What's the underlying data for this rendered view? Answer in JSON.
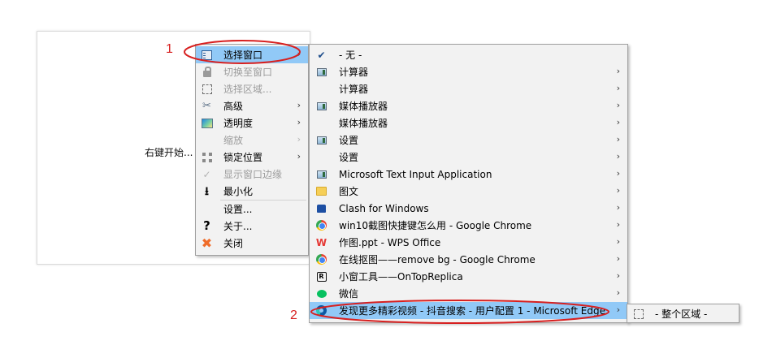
{
  "background_window": {
    "hint": "右键开始..."
  },
  "main_menu": [
    {
      "label": "选择窗口",
      "icon": "select-window-icon",
      "arrow": "›",
      "state": "highlight"
    },
    {
      "label": "切换至窗口",
      "icon": "lock-icon",
      "state": "disabled"
    },
    {
      "label": "选择区域...",
      "icon": "select-region-icon",
      "state": "disabled"
    },
    {
      "label": "高级",
      "icon": "wrench-icon",
      "arrow": "›"
    },
    {
      "label": "透明度",
      "icon": "opacity-icon",
      "arrow": "›"
    },
    {
      "label": "缩放",
      "arrow": "›",
      "state": "disabled"
    },
    {
      "label": "锁定位置",
      "icon": "grid-icon",
      "arrow": "›"
    },
    {
      "label": "显示窗口边缘",
      "icon": "check-icon",
      "state": "disabled"
    },
    {
      "label": "最小化",
      "icon": "minimize-icon"
    },
    {
      "label": "设置...",
      "separator_before": true
    },
    {
      "label": "关于...",
      "icon": "question-icon"
    },
    {
      "label": "关闭",
      "icon": "close-icon"
    }
  ],
  "window_menu": [
    {
      "label": "- 无 -",
      "icon": "check-icon"
    },
    {
      "label": "计算器",
      "icon": "app-window-icon",
      "arrow": "›"
    },
    {
      "label": "计算器",
      "arrow": "›"
    },
    {
      "label": "媒体播放器",
      "icon": "app-window-icon",
      "arrow": "›"
    },
    {
      "label": "媒体播放器",
      "arrow": "›"
    },
    {
      "label": "设置",
      "icon": "app-window-icon",
      "arrow": "›"
    },
    {
      "label": "设置",
      "arrow": "›"
    },
    {
      "label": "Microsoft Text Input Application",
      "icon": "app-window-icon",
      "arrow": "›"
    },
    {
      "label": "图文",
      "icon": "folder-icon",
      "arrow": "›"
    },
    {
      "label": "Clash for Windows",
      "icon": "clash-icon",
      "arrow": "›"
    },
    {
      "label": "win10截图快捷键怎么用 - Google Chrome",
      "icon": "chrome-icon",
      "arrow": "›"
    },
    {
      "label": "作图.ppt - WPS Office",
      "icon": "wps-icon",
      "arrow": "›"
    },
    {
      "label": "在线抠图——remove bg - Google Chrome",
      "icon": "chrome-icon",
      "arrow": "›"
    },
    {
      "label": "小窗工具——OnTopReplica",
      "icon": "ontopreplica-icon",
      "arrow": "›"
    },
    {
      "label": "微信",
      "icon": "wechat-icon",
      "arrow": "›"
    },
    {
      "label": "发现更多精彩视频 - 抖音搜索 - 用户配置 1 - Microsoft Edge",
      "icon": "edge-icon",
      "arrow": "›",
      "state": "highlight"
    }
  ],
  "area_menu": {
    "label": "- 整个区域 -",
    "icon": "region-icon"
  },
  "annotations": {
    "label_1": "1",
    "label_2": "2",
    "ellipse_color": "#d72020"
  },
  "colors": {
    "highlight": "#91c9f7",
    "menu_bg": "#f2f2f2"
  }
}
